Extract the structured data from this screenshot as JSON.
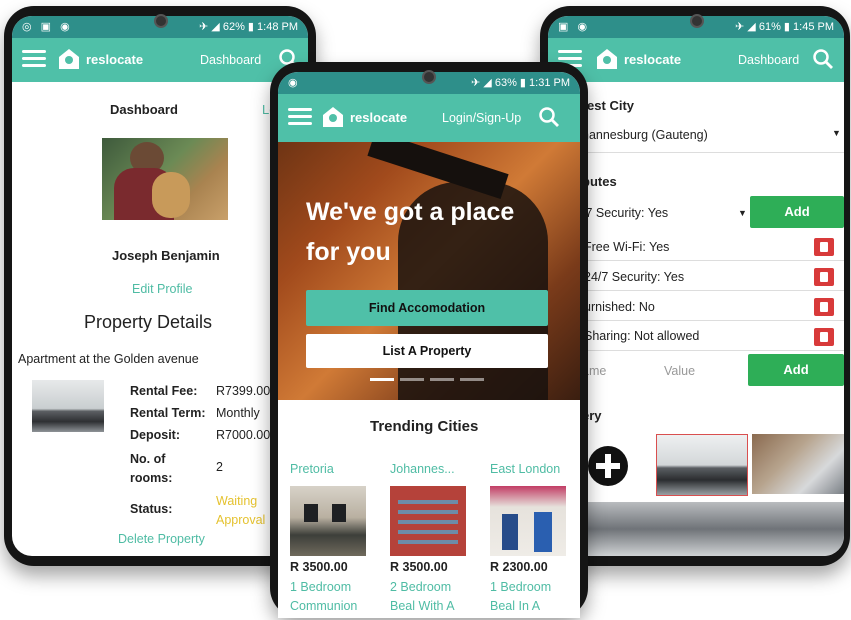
{
  "colors": {
    "accent": "#4fc0a8",
    "statusbar": "#2e8f8a",
    "add_button": "#2eae57",
    "delete_button": "#d83a3a",
    "waiting": "#e5c22f"
  },
  "brand": "reslocate",
  "left_phone": {
    "status_time": "1:48 PM",
    "status_battery": "62%",
    "nav_link": "Dashboard",
    "page_title": "Dashboard",
    "logout_partial": "Lo",
    "user_name": "Joseph Benjamin",
    "edit_profile": "Edit Profile",
    "section_title": "Property Details",
    "property_name": "Apartment at the Golden avenue",
    "details": [
      {
        "label": "Rental Fee:",
        "value": "R7399.00"
      },
      {
        "label": "Rental Term:",
        "value": "Monthly"
      },
      {
        "label": "Deposit:",
        "value": "R7000.00"
      },
      {
        "label": "No. of rooms:",
        "value": "2"
      }
    ],
    "status_label": "Status:",
    "status_value": "Waiting Approval",
    "delete_property": "Delete Property"
  },
  "center_phone": {
    "status_time": "1:31 PM",
    "status_battery": "63%",
    "nav_link": "Login/Sign-Up",
    "hero_line1": "We've got a place",
    "hero_line2": "for you",
    "find_button": "Find Accomodation",
    "list_button": "List A Property",
    "trending_title": "Trending Cities",
    "cities": [
      {
        "name": "Pretoria",
        "price": "R 3500.00",
        "line1": "1 Bedroom",
        "line2": "Communion"
      },
      {
        "name": "Johannes...",
        "price": "R 3500.00",
        "line1": "2 Bedroom",
        "line2": "Beal With A"
      },
      {
        "name": "East London",
        "price": "R 2300.00",
        "line1": "1 Bedroom",
        "line2": "Beal In A"
      }
    ]
  },
  "right_phone": {
    "status_time": "1:45 PM",
    "status_battery": "61%",
    "nav_link": "Dashboard",
    "nearest_city_label": "rest City",
    "nearest_city_value": "hannesburg (Gauteng)",
    "attributes_label": "butes",
    "attribute_select": "/7 Security: Yes",
    "add_label": "Add",
    "attributes": [
      "Free Wi-Fi: Yes",
      "24/7 Security: Yes",
      "urnished: No",
      "Sharing: Not allowed"
    ],
    "name_placeholder": "ame",
    "value_placeholder": "Value",
    "gallery_label": "ery"
  }
}
